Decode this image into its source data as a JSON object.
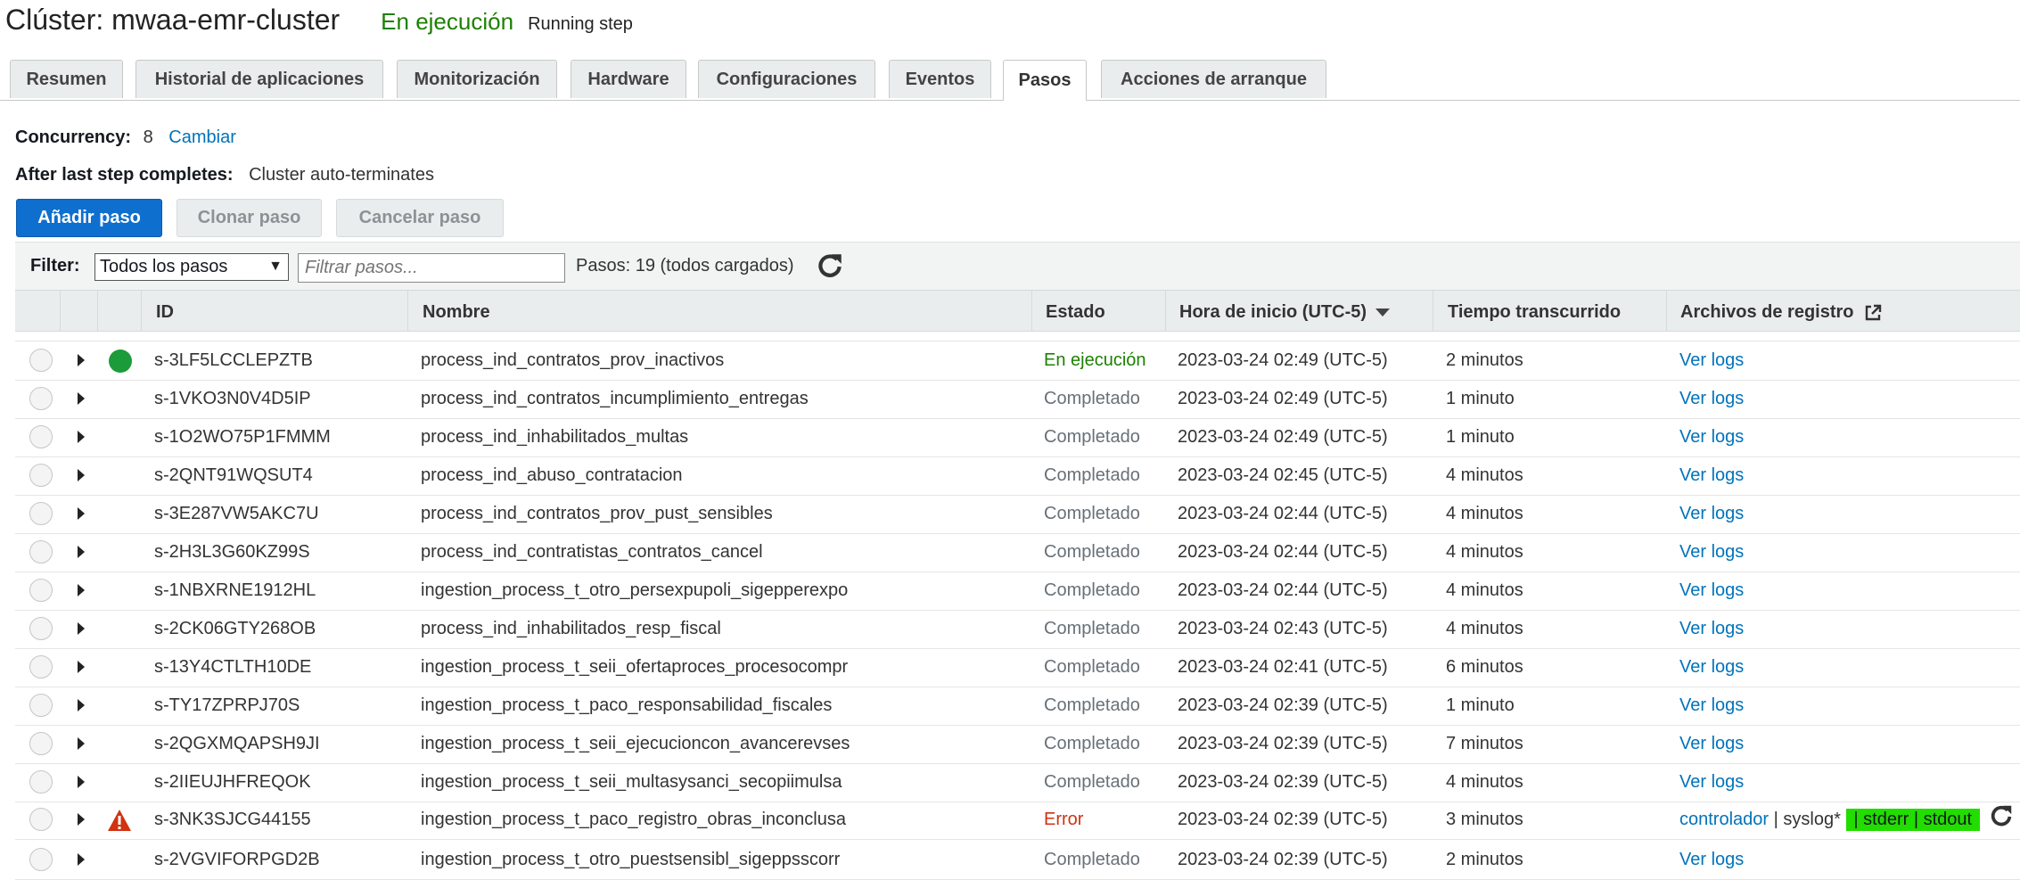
{
  "header": {
    "title": "Clúster: mwaa-emr-cluster",
    "state": "En ejecución",
    "substate": "Running step"
  },
  "tabs": [
    {
      "label": "Resumen"
    },
    {
      "label": "Historial de aplicaciones"
    },
    {
      "label": "Monitorización"
    },
    {
      "label": "Hardware"
    },
    {
      "label": "Configuraciones"
    },
    {
      "label": "Eventos"
    },
    {
      "label": "Pasos"
    },
    {
      "label": "Acciones de arranque"
    }
  ],
  "active_tab": "Pasos",
  "concurrency": {
    "label": "Concurrency:",
    "value": "8",
    "change_link": "Cambiar"
  },
  "after_last_step": {
    "label": "After last step completes:",
    "value": "Cluster auto-terminates"
  },
  "buttons": {
    "add": "Añadir paso",
    "clone": "Clonar paso",
    "cancel": "Cancelar paso"
  },
  "filter": {
    "label": "Filter:",
    "selected": "Todos los pasos",
    "placeholder": "Filtrar pasos...",
    "count_text": "Pasos: 19 (todos cargados)"
  },
  "columns": {
    "id": "ID",
    "name": "Nombre",
    "status": "Estado",
    "start": "Hora de inicio (UTC-5)",
    "elapsed": "Tiempo transcurrido",
    "logs": "Archivos de registro"
  },
  "colors": {
    "running": "#1d8102",
    "completed": "#687078",
    "error": "#d13212",
    "link": "#0073bb",
    "primary_button": "#0f6fcf",
    "highlight": "#22dd00"
  },
  "rows": [
    {
      "id": "s-3LF5LCCLEPZTB",
      "name": "process_ind_contratos_prov_inactivos",
      "status": "En ejecución",
      "status_kind": "running",
      "start": "2023-03-24 02:49 (UTC-5)",
      "elapsed": "2 minutos",
      "logs": "Ver logs"
    },
    {
      "id": "s-1VKO3N0V4D5IP",
      "name": "process_ind_contratos_incumplimiento_entregas",
      "status": "Completado",
      "status_kind": "done",
      "start": "2023-03-24 02:49 (UTC-5)",
      "elapsed": "1 minuto",
      "logs": "Ver logs"
    },
    {
      "id": "s-1O2WO75P1FMMM",
      "name": "process_ind_inhabilitados_multas",
      "status": "Completado",
      "status_kind": "done",
      "start": "2023-03-24 02:49 (UTC-5)",
      "elapsed": "1 minuto",
      "logs": "Ver logs"
    },
    {
      "id": "s-2QNT91WQSUT4",
      "name": "process_ind_abuso_contratacion",
      "status": "Completado",
      "status_kind": "done",
      "start": "2023-03-24 02:45 (UTC-5)",
      "elapsed": "4 minutos",
      "logs": "Ver logs"
    },
    {
      "id": "s-3E287VW5AKC7U",
      "name": "process_ind_contratos_prov_pust_sensibles",
      "status": "Completado",
      "status_kind": "done",
      "start": "2023-03-24 02:44 (UTC-5)",
      "elapsed": "4 minutos",
      "logs": "Ver logs"
    },
    {
      "id": "s-2H3L3G60KZ99S",
      "name": "process_ind_contratistas_contratos_cancel",
      "status": "Completado",
      "status_kind": "done",
      "start": "2023-03-24 02:44 (UTC-5)",
      "elapsed": "4 minutos",
      "logs": "Ver logs"
    },
    {
      "id": "s-1NBXRNE1912HL",
      "name": "ingestion_process_t_otro_persexpupoli_sigepperexpo",
      "status": "Completado",
      "status_kind": "done",
      "start": "2023-03-24 02:44 (UTC-5)",
      "elapsed": "4 minutos",
      "logs": "Ver logs"
    },
    {
      "id": "s-2CK06GTY268OB",
      "name": "process_ind_inhabilitados_resp_fiscal",
      "status": "Completado",
      "status_kind": "done",
      "start": "2023-03-24 02:43 (UTC-5)",
      "elapsed": "4 minutos",
      "logs": "Ver logs"
    },
    {
      "id": "s-13Y4CTLTH10DE",
      "name": "ingestion_process_t_seii_ofertaproces_procesocompr",
      "status": "Completado",
      "status_kind": "done",
      "start": "2023-03-24 02:41 (UTC-5)",
      "elapsed": "6 minutos",
      "logs": "Ver logs"
    },
    {
      "id": "s-TY17ZPRPJ70S",
      "name": "ingestion_process_t_paco_responsabilidad_fiscales",
      "status": "Completado",
      "status_kind": "done",
      "start": "2023-03-24 02:39 (UTC-5)",
      "elapsed": "1 minuto",
      "logs": "Ver logs"
    },
    {
      "id": "s-2QGXMQAPSH9JI",
      "name": "ingestion_process_t_seii_ejecucioncon_avancerevses",
      "status": "Completado",
      "status_kind": "done",
      "start": "2023-03-24 02:39 (UTC-5)",
      "elapsed": "7 minutos",
      "logs": "Ver logs"
    },
    {
      "id": "s-2IIEUJHFREQOK",
      "name": "ingestion_process_t_seii_multasysanci_secopiimulsa",
      "status": "Completado",
      "status_kind": "done",
      "start": "2023-03-24 02:39 (UTC-5)",
      "elapsed": "4 minutos",
      "logs": "Ver logs"
    },
    {
      "id": "s-3NK3SJCG44155",
      "name": "ingestion_process_t_paco_registro_obras_inconclusa",
      "status": "Error",
      "status_kind": "error",
      "start": "2023-03-24 02:39 (UTC-5)",
      "elapsed": "3 minutos",
      "logs": "",
      "log_links": {
        "controller": "controlador",
        "sep1": " | ",
        "syslog": "syslog*",
        "highlighted": " | stderr | stdout "
      }
    },
    {
      "id": "s-2VGVIFORPGD2B",
      "name": "ingestion_process_t_otro_puestsensibl_sigeppsscorr",
      "status": "Completado",
      "status_kind": "done",
      "start": "2023-03-24 02:39 (UTC-5)",
      "elapsed": "2 minutos",
      "logs": "Ver logs"
    }
  ]
}
